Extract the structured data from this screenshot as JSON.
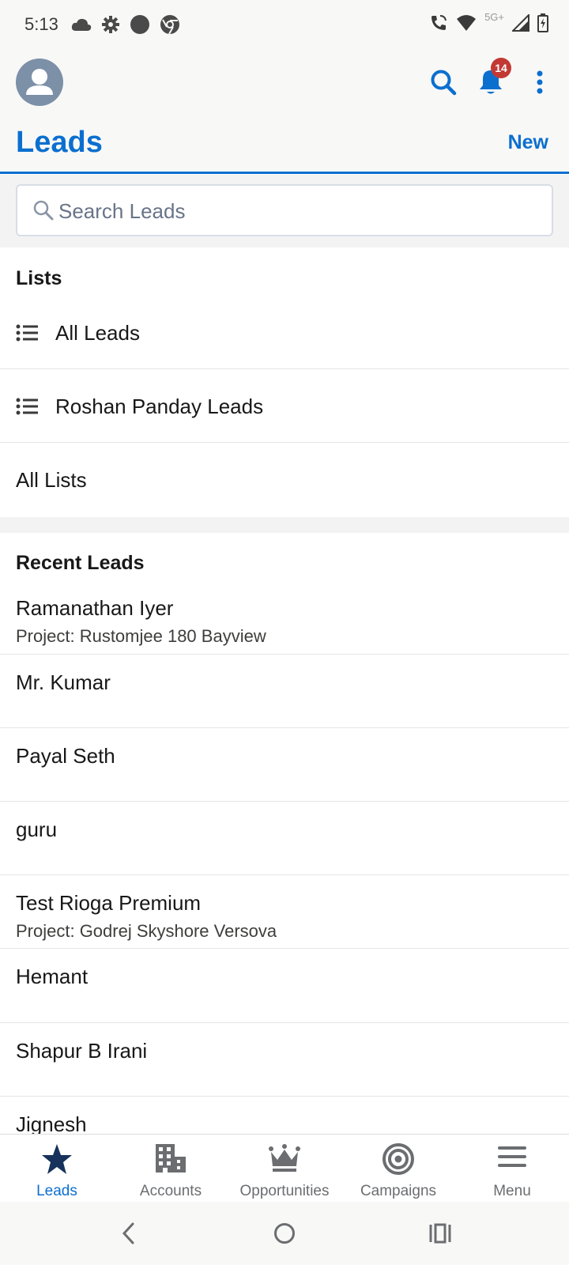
{
  "status_bar": {
    "time": "5:13",
    "network": "5G+",
    "left_icons": [
      "cloud-icon",
      "settings-gear-icon",
      "circle-dot-icon",
      "chrome-icon"
    ],
    "right_icons": [
      "wifi-call-icon",
      "wifi-icon",
      "signal-icon",
      "battery-charging-icon"
    ]
  },
  "header": {
    "title": "Leads",
    "new_label": "New",
    "notification_count": "14"
  },
  "search": {
    "placeholder": "Search Leads",
    "value": ""
  },
  "lists": {
    "heading": "Lists",
    "items": [
      {
        "label": "All Leads",
        "icon": "list-icon"
      },
      {
        "label": "Roshan Panday Leads",
        "icon": "list-icon"
      }
    ],
    "all_lists_label": "All Lists"
  },
  "recent": {
    "heading": "Recent Leads",
    "items": [
      {
        "name": "Ramanathan Iyer",
        "subtitle": "Project: Rustomjee 180 Bayview"
      },
      {
        "name": "Mr. Kumar",
        "subtitle": ""
      },
      {
        "name": "Payal Seth",
        "subtitle": ""
      },
      {
        "name": "guru",
        "subtitle": ""
      },
      {
        "name": "Test Rioga Premium",
        "subtitle": "Project: Godrej Skyshore Versova"
      },
      {
        "name": "Hemant",
        "subtitle": ""
      },
      {
        "name": "Shapur B Irani",
        "subtitle": ""
      },
      {
        "name": "Jignesh",
        "subtitle": ""
      }
    ]
  },
  "tabs": [
    {
      "label": "Leads",
      "icon": "star-icon",
      "active": true
    },
    {
      "label": "Accounts",
      "icon": "building-icon",
      "active": false
    },
    {
      "label": "Opportunities",
      "icon": "crown-icon",
      "active": false
    },
    {
      "label": "Campaigns",
      "icon": "target-icon",
      "active": false
    },
    {
      "label": "Menu",
      "icon": "hamburger-menu-icon",
      "active": false
    }
  ],
  "colors": {
    "brand_blue": "#0b6fcf",
    "badge_red": "#c23934",
    "tab_inactive": "#6b6d70",
    "avatar_bg": "#7c90a8"
  }
}
